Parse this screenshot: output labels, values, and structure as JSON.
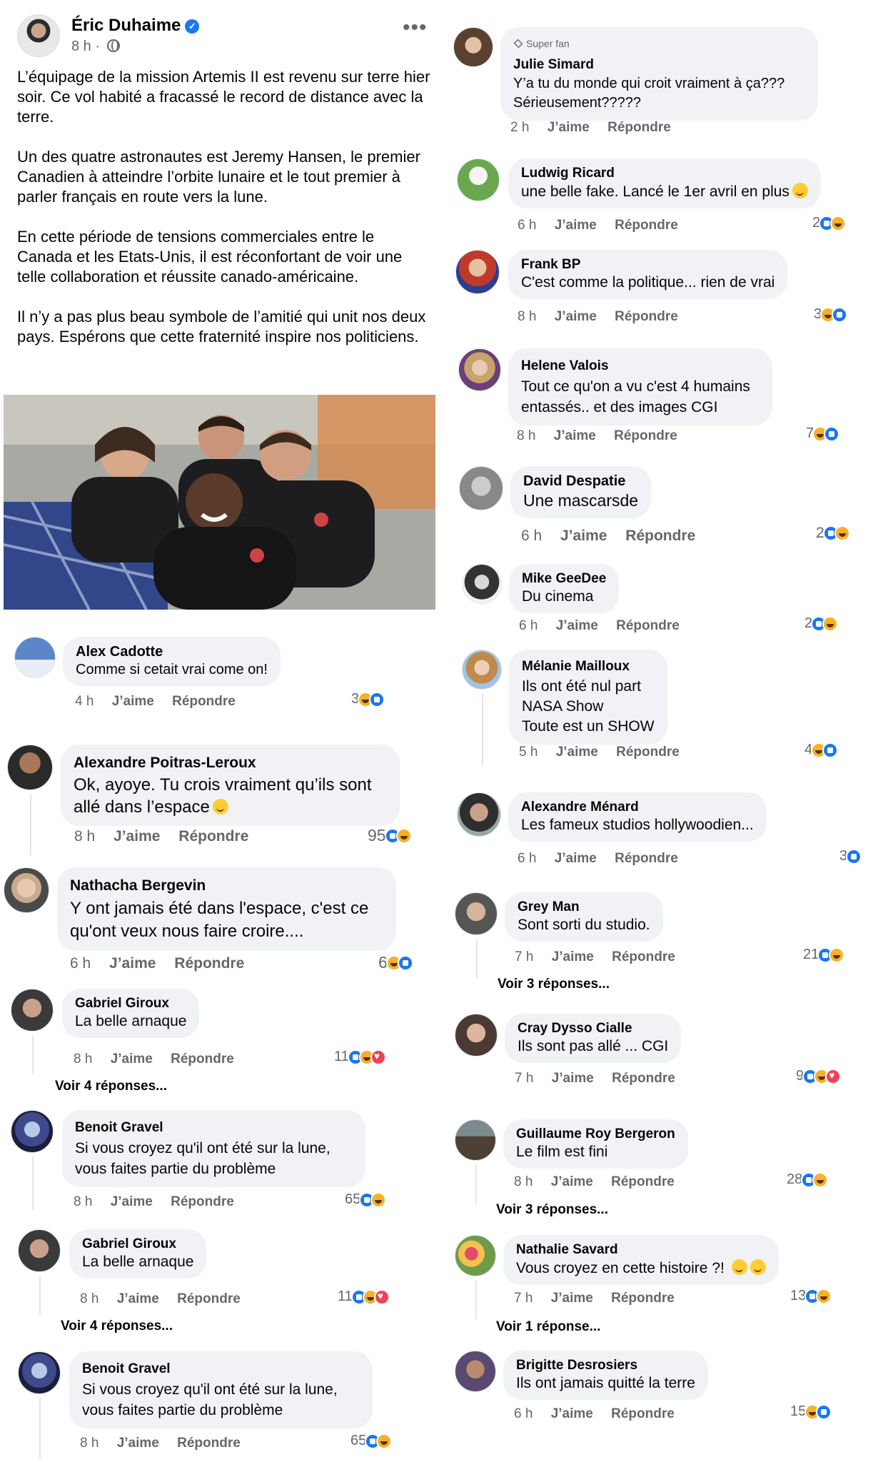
{
  "post": {
    "author": "Éric Duhaime",
    "time": "8 h ·",
    "paragraphs": [
      "L’équipage de la mission Artemis II est revenu sur terre hier soir. Ce vol habité a fracassé le record de distance avec la terre.",
      "Un des quatre astronautes est Jeremy Hansen, le premier Canadien à atteindre l’orbite lunaire et le tout premier à parler français en route vers la lune.",
      "En cette période de tensions commerciales entre le Canada et les Etats-Unis, il est réconfortant de voir une telle collaboration et réussite canado-américaine.",
      "Il n’y a pas plus beau symbole de l’amitié qui unit nos deux pays. Espérons que cette fraternité inspire nos politiciens."
    ]
  },
  "labels": {
    "like": "J’aime",
    "reply": "Répondre"
  },
  "left_comments": [
    {
      "name": "Alex Cadotte",
      "text": "Comme si cetait vrai come on!",
      "time": "4 h",
      "count": "3"
    },
    {
      "name": "Alexandre Poitras-Leroux",
      "text": "Ok, ayoye.  Tu crois vraiment qu’ils sont allé dans l’espace",
      "time": "8 h",
      "count": "95"
    },
    {
      "name": "Nathacha Bergevin",
      "text": "Y ont jamais été dans l'espace, c'est ce qu'ont veux nous faire croire....",
      "time": "6 h",
      "count": "6"
    },
    {
      "name": "Gabriel Giroux",
      "text": "La belle arnaque",
      "time": "8 h",
      "count": "11",
      "replies": "Voir 4 réponses..."
    },
    {
      "name": "Benoit Gravel",
      "text": "Si vous croyez qu'il ont été sur la lune, vous faites partie du problème",
      "time": "8 h",
      "count": "65"
    },
    {
      "name": "Gabriel Giroux",
      "text": "La belle arnaque",
      "time": "8 h",
      "count": "11",
      "replies": "Voir 4 réponses..."
    },
    {
      "name": "Benoit Gravel",
      "text": "Si vous croyez qu'il ont été sur la lune, vous faites partie du problème",
      "time": "8 h",
      "count": "65"
    }
  ],
  "right_comments": [
    {
      "badge": "Super fan",
      "name": "Julie Simard",
      "text": "Y’a tu du monde qui croit vraiment à ça??? Sérieusement?????",
      "time": "2 h"
    },
    {
      "name": "Ludwig Ricard",
      "text": "une belle fake. Lancé le 1er avril en plus",
      "time": "6 h",
      "count": "2"
    },
    {
      "name": "Frank BP",
      "text": "C'est comme la politique... rien de vrai",
      "time": "8 h",
      "count": "3"
    },
    {
      "name": "Helene Valois",
      "text": "Tout ce qu'on a vu c'est 4 humains entassés.. et des images CGI",
      "time": "8 h",
      "count": "7"
    },
    {
      "name": "David Despatie",
      "text": "Une mascarsde",
      "time": "6 h",
      "count": "2"
    },
    {
      "name": "Mike GeeDee",
      "text": "Du cinema",
      "time": "6 h",
      "count": "2"
    },
    {
      "name": "Mélanie Mailloux",
      "text_lines": [
        "Ils ont été nul part",
        "NASA Show",
        "Toute est un SHOW"
      ],
      "time": "5 h",
      "count": "4"
    },
    {
      "name": "Alexandre Ménard",
      "text": "Les fameux studios hollywoodien...",
      "time": "6 h",
      "count": "3"
    },
    {
      "name": "Grey Man",
      "text": "Sont sorti du studio.",
      "time": "7 h",
      "count": "21",
      "replies": "Voir 3 réponses..."
    },
    {
      "name": "Cray Dysso Cialle",
      "text": "Ils sont pas allé ...  CGI",
      "time": "7 h",
      "count": "9"
    },
    {
      "name": "Guillaume Roy Bergeron",
      "text": "Le film est fini",
      "time": "8 h",
      "count": "28",
      "replies": "Voir 3 réponses..."
    },
    {
      "name": "Nathalie Savard",
      "text": "Vous croyez en cette histoire ?!",
      "time": "7 h",
      "count": "13",
      "replies": "Voir 1 réponse..."
    },
    {
      "name": "Brigitte Desrosiers",
      "text": "Ils ont jamais quitté la terre",
      "time": "6 h",
      "count": "15"
    }
  ],
  "colors": {
    "bubble": "#f0f2f5",
    "meta": "#65676b",
    "like_blue": "#1877f2",
    "haha_yellow": "#f7b125",
    "love_red": "#f33e58"
  }
}
